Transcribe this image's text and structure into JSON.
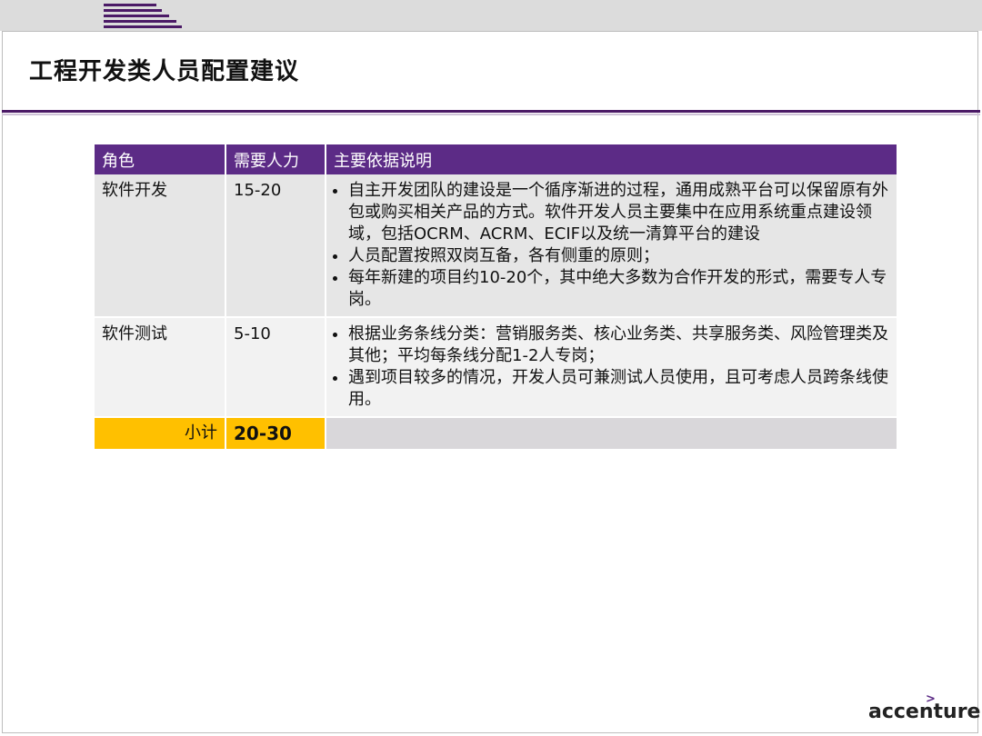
{
  "header": {
    "title": "工程开发类人员配置建议"
  },
  "table": {
    "columns": [
      "角色",
      "需要人力",
      "主要依据说明"
    ],
    "rows": [
      {
        "role": "软件开发",
        "headcount": "15-20",
        "bullets": [
          "自主开发团队的建设是一个循序渐进的过程，通用成熟平台可以保留原有外包或购买相关产品的方式。软件开发人员主要集中在应用系统重点建设领域，包括OCRM、ACRM、ECIF以及统一清算平台的建设",
          "人员配置按照双岗互备，各有侧重的原则；",
          "每年新建的项目约10-20个，其中绝大多数为合作开发的形式，需要专人专岗。"
        ]
      },
      {
        "role": "软件测试",
        "headcount": "5-10",
        "bullets": [
          "根据业务条线分类：营销服务类、核心业务类、共享服务类、风险管理类及其他；平均每条线分配1-2人专岗；",
          "遇到项目较多的情况，开发人员可兼测试人员使用，且可考虑人员跨条线使用。"
        ]
      }
    ],
    "subtotal": {
      "label": "小计",
      "value": "20-30"
    }
  },
  "footer": {
    "brand": "accenture",
    "brand_mark": ">"
  },
  "colors": {
    "header_purple": "#5c2b86",
    "subtotal_yellow": "#ffc000",
    "row_gray": "#e6e6e6"
  }
}
